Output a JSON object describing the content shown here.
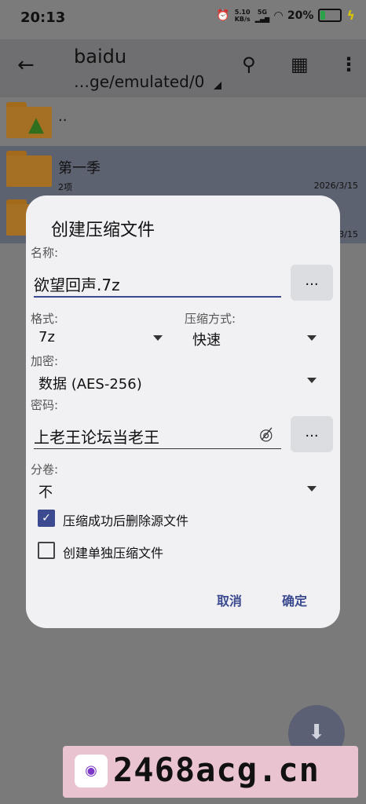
{
  "status_bar": {
    "time": "20:13",
    "net_speed_value": "5.10",
    "net_speed_unit": "KB/s",
    "signal_label": "5G",
    "battery_percent": "20%",
    "battery_level": 0.2,
    "icons": [
      "alarm-icon",
      "signal-icon",
      "wifi-icon",
      "battery-icon",
      "charging-icon"
    ]
  },
  "toolbar": {
    "back_icon": "back-arrow-icon",
    "title": "baidu",
    "path": "…ge/emulated/0",
    "search_icon": "search-icon",
    "grid_icon": "grid-view-icon",
    "more_icon": "more-vert-icon"
  },
  "file_list": [
    {
      "name": "..",
      "sub": "",
      "date": "",
      "icon": "folder-up-icon"
    },
    {
      "name": "第一季",
      "sub": "2项",
      "date": "2026/3/15",
      "icon": "folder-icon",
      "selected": true
    },
    {
      "name": "",
      "sub": "",
      "date": "3/15",
      "icon": "folder-icon",
      "selected": true
    }
  ],
  "dialog": {
    "title": "创建压缩文件",
    "name_label": "名称:",
    "name_value": "欲望回声.7z",
    "browse_button": "...",
    "format_label": "格式:",
    "format_value": "7z",
    "method_label": "压缩方式:",
    "method_value": "快速",
    "encryption_label": "加密:",
    "encryption_value": "数据 (AES-256)",
    "password_label": "密码:",
    "password_value": "上老王论坛当老王",
    "password_button": "...",
    "volume_label": "分卷:",
    "volume_value": "不",
    "delete_source_label": "压缩成功后删除源文件",
    "delete_source_checked": true,
    "separate_archive_label": "创建单独压缩文件",
    "separate_archive_checked": false,
    "cancel_label": "取消",
    "ok_label": "确定"
  },
  "fab": {
    "icon": "download-icon"
  },
  "banner": {
    "text": "2468acg.cn"
  }
}
